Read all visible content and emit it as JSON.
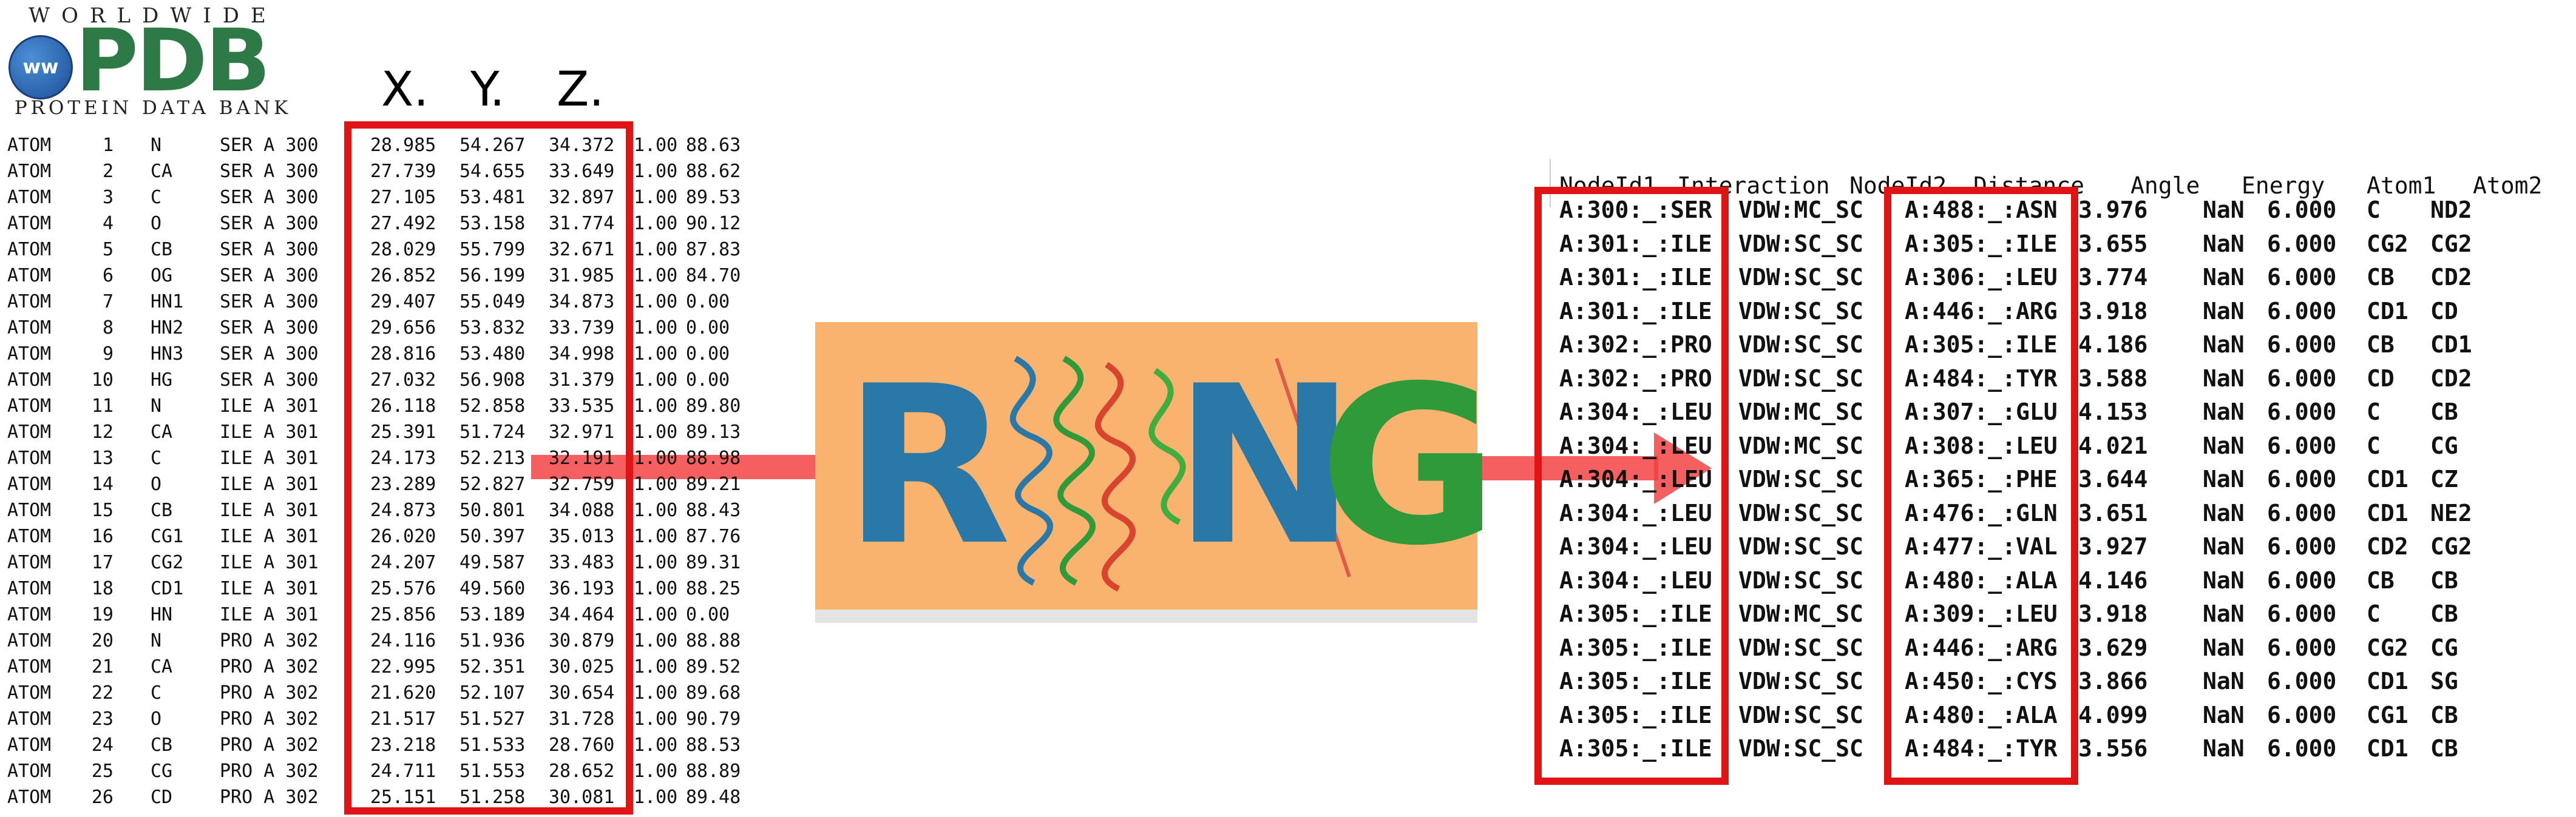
{
  "logo": {
    "top_text": "WORLDWIDE",
    "main_text": "PDB",
    "badge_text": "ww",
    "bottom_text": "PROTEIN DATA BANK"
  },
  "axis_labels": [
    "X.",
    "Y.",
    "Z."
  ],
  "atom_records": [
    [
      "ATOM",
      "1",
      "N",
      "SER A 300",
      "28.985",
      "54.267",
      "34.372",
      "1.00",
      "88.63"
    ],
    [
      "ATOM",
      "2",
      "CA",
      "SER A 300",
      "27.739",
      "54.655",
      "33.649",
      "1.00",
      "88.62"
    ],
    [
      "ATOM",
      "3",
      "C",
      "SER A 300",
      "27.105",
      "53.481",
      "32.897",
      "1.00",
      "89.53"
    ],
    [
      "ATOM",
      "4",
      "O",
      "SER A 300",
      "27.492",
      "53.158",
      "31.774",
      "1.00",
      "90.12"
    ],
    [
      "ATOM",
      "5",
      "CB",
      "SER A 300",
      "28.029",
      "55.799",
      "32.671",
      "1.00",
      "87.83"
    ],
    [
      "ATOM",
      "6",
      "OG",
      "SER A 300",
      "26.852",
      "56.199",
      "31.985",
      "1.00",
      "84.70"
    ],
    [
      "ATOM",
      "7",
      "HN1",
      "SER A 300",
      "29.407",
      "55.049",
      "34.873",
      "1.00",
      "0.00"
    ],
    [
      "ATOM",
      "8",
      "HN2",
      "SER A 300",
      "29.656",
      "53.832",
      "33.739",
      "1.00",
      "0.00"
    ],
    [
      "ATOM",
      "9",
      "HN3",
      "SER A 300",
      "28.816",
      "53.480",
      "34.998",
      "1.00",
      "0.00"
    ],
    [
      "ATOM",
      "10",
      "HG",
      "SER A 300",
      "27.032",
      "56.908",
      "31.379",
      "1.00",
      "0.00"
    ],
    [
      "ATOM",
      "11",
      "N",
      "ILE A 301",
      "26.118",
      "52.858",
      "33.535",
      "1.00",
      "89.80"
    ],
    [
      "ATOM",
      "12",
      "CA",
      "ILE A 301",
      "25.391",
      "51.724",
      "32.971",
      "1.00",
      "89.13"
    ],
    [
      "ATOM",
      "13",
      "C",
      "ILE A 301",
      "24.173",
      "52.213",
      "32.191",
      "1.00",
      "88.98"
    ],
    [
      "ATOM",
      "14",
      "O",
      "ILE A 301",
      "23.289",
      "52.827",
      "32.759",
      "1.00",
      "89.21"
    ],
    [
      "ATOM",
      "15",
      "CB",
      "ILE A 301",
      "24.873",
      "50.801",
      "34.088",
      "1.00",
      "88.43"
    ],
    [
      "ATOM",
      "16",
      "CG1",
      "ILE A 301",
      "26.020",
      "50.397",
      "35.013",
      "1.00",
      "87.76"
    ],
    [
      "ATOM",
      "17",
      "CG2",
      "ILE A 301",
      "24.207",
      "49.587",
      "33.483",
      "1.00",
      "89.31"
    ],
    [
      "ATOM",
      "18",
      "CD1",
      "ILE A 301",
      "25.576",
      "49.560",
      "36.193",
      "1.00",
      "88.25"
    ],
    [
      "ATOM",
      "19",
      "HN",
      "ILE A 301",
      "25.856",
      "53.189",
      "34.464",
      "1.00",
      "0.00"
    ],
    [
      "ATOM",
      "20",
      "N",
      "PRO A 302",
      "24.116",
      "51.936",
      "30.879",
      "1.00",
      "88.88"
    ],
    [
      "ATOM",
      "21",
      "CA",
      "PRO A 302",
      "22.995",
      "52.351",
      "30.025",
      "1.00",
      "89.52"
    ],
    [
      "ATOM",
      "22",
      "C",
      "PRO A 302",
      "21.620",
      "52.107",
      "30.654",
      "1.00",
      "89.68"
    ],
    [
      "ATOM",
      "23",
      "O",
      "PRO A 302",
      "21.517",
      "51.527",
      "31.728",
      "1.00",
      "90.79"
    ],
    [
      "ATOM",
      "24",
      "CB",
      "PRO A 302",
      "23.218",
      "51.533",
      "28.760",
      "1.00",
      "88.53"
    ],
    [
      "ATOM",
      "25",
      "CG",
      "PRO A 302",
      "24.711",
      "51.553",
      "28.652",
      "1.00",
      "88.89"
    ],
    [
      "ATOM",
      "26",
      "CD",
      "PRO A 302",
      "25.151",
      "51.258",
      "30.081",
      "1.00",
      "89.48"
    ]
  ],
  "ring_logo": {
    "letters": [
      "R",
      "I",
      "N",
      "G"
    ]
  },
  "ring_headers": [
    "NodeId1",
    "Interaction",
    "NodeId2",
    "Distance",
    "Angle",
    "Energy",
    "Atom1",
    "Atom2"
  ],
  "ring_rows": [
    [
      "A:300:_:SER",
      "VDW:MC_SC",
      "A:488:_:ASN",
      "3.976",
      "NaN",
      "6.000",
      "C",
      "ND2"
    ],
    [
      "A:301:_:ILE",
      "VDW:SC_SC",
      "A:305:_:ILE",
      "3.655",
      "NaN",
      "6.000",
      "CG2",
      "CG2"
    ],
    [
      "A:301:_:ILE",
      "VDW:SC_SC",
      "A:306:_:LEU",
      "3.774",
      "NaN",
      "6.000",
      "CB",
      "CD2"
    ],
    [
      "A:301:_:ILE",
      "VDW:SC_SC",
      "A:446:_:ARG",
      "3.918",
      "NaN",
      "6.000",
      "CD1",
      "CD"
    ],
    [
      "A:302:_:PRO",
      "VDW:SC_SC",
      "A:305:_:ILE",
      "4.186",
      "NaN",
      "6.000",
      "CB",
      "CD1"
    ],
    [
      "A:302:_:PRO",
      "VDW:SC_SC",
      "A:484:_:TYR",
      "3.588",
      "NaN",
      "6.000",
      "CD",
      "CD2"
    ],
    [
      "A:304:_:LEU",
      "VDW:MC_SC",
      "A:307:_:GLU",
      "4.153",
      "NaN",
      "6.000",
      "C",
      "CB"
    ],
    [
      "A:304:_:LEU",
      "VDW:MC_SC",
      "A:308:_:LEU",
      "4.021",
      "NaN",
      "6.000",
      "C",
      "CG"
    ],
    [
      "A:304:_:LEU",
      "VDW:SC_SC",
      "A:365:_:PHE",
      "3.644",
      "NaN",
      "6.000",
      "CD1",
      "CZ"
    ],
    [
      "A:304:_:LEU",
      "VDW:SC_SC",
      "A:476:_:GLN",
      "3.651",
      "NaN",
      "6.000",
      "CD1",
      "NE2"
    ],
    [
      "A:304:_:LEU",
      "VDW:SC_SC",
      "A:477:_:VAL",
      "3.927",
      "NaN",
      "6.000",
      "CD2",
      "CG2"
    ],
    [
      "A:304:_:LEU",
      "VDW:SC_SC",
      "A:480:_:ALA",
      "4.146",
      "NaN",
      "6.000",
      "CB",
      "CB"
    ],
    [
      "A:305:_:ILE",
      "VDW:MC_SC",
      "A:309:_:LEU",
      "3.918",
      "NaN",
      "6.000",
      "C",
      "CB"
    ],
    [
      "A:305:_:ILE",
      "VDW:SC_SC",
      "A:446:_:ARG",
      "3.629",
      "NaN",
      "6.000",
      "CG2",
      "CG"
    ],
    [
      "A:305:_:ILE",
      "VDW:SC_SC",
      "A:450:_:CYS",
      "3.866",
      "NaN",
      "6.000",
      "CD1",
      "SG"
    ],
    [
      "A:305:_:ILE",
      "VDW:SC_SC",
      "A:480:_:ALA",
      "4.099",
      "NaN",
      "6.000",
      "CG1",
      "CB"
    ],
    [
      "A:305:_:ILE",
      "VDW:SC_SC",
      "A:484:_:TYR",
      "3.556",
      "NaN",
      "6.000",
      "CD1",
      "CB"
    ]
  ],
  "colors": {
    "highlight_red": "#e01414",
    "arrow_red": "#f43c3c",
    "ring_background": "#f8b36e",
    "ring_blue": "#2a78a8",
    "ring_green": "#2e9a3a",
    "pdb_green": "#2d7a47"
  }
}
